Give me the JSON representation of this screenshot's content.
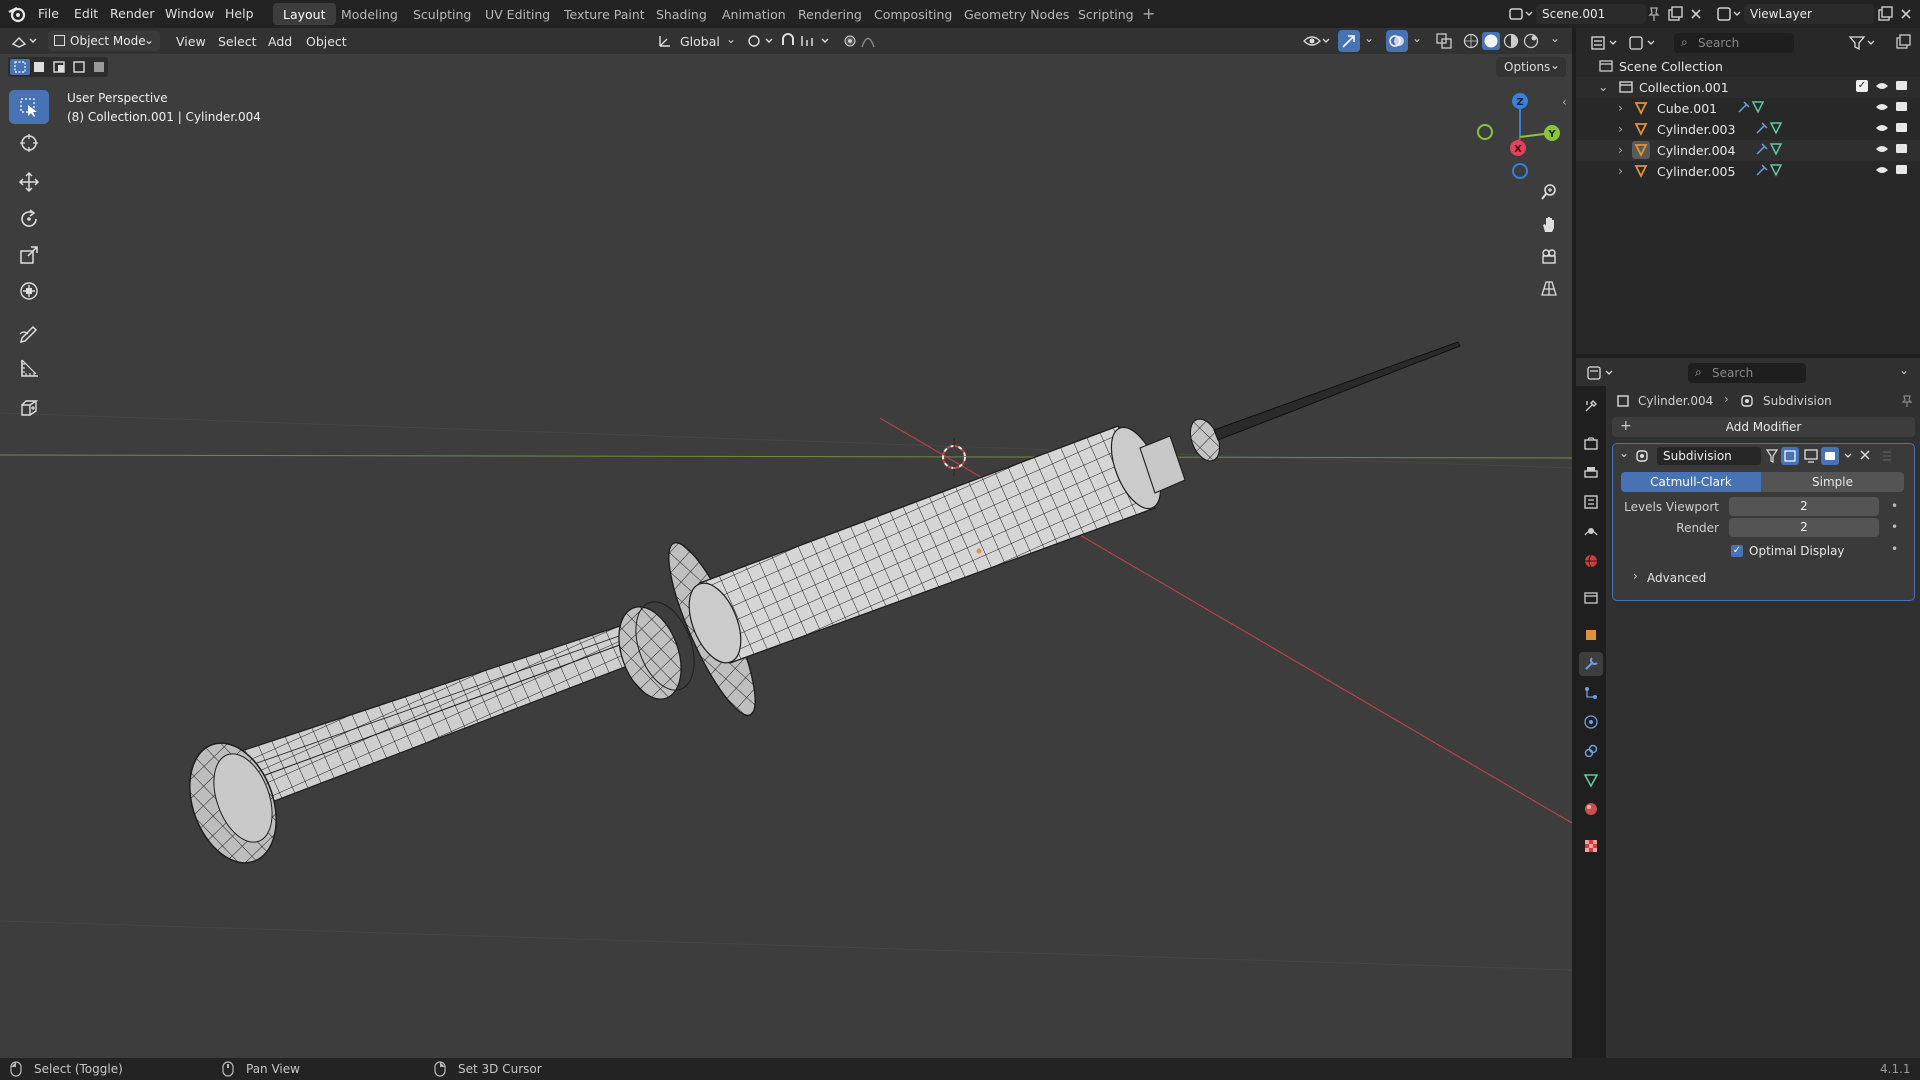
{
  "topbar": {
    "menus": [
      "File",
      "Edit",
      "Render",
      "Window",
      "Help"
    ],
    "workspaces": [
      "Layout",
      "Modeling",
      "Sculpting",
      "UV Editing",
      "Texture Paint",
      "Shading",
      "Animation",
      "Rendering",
      "Compositing",
      "Geometry Nodes",
      "Scripting"
    ],
    "active_workspace": "Layout",
    "add_tab": "+",
    "scene": "Scene.001",
    "view_layer": "ViewLayer"
  },
  "viewport_header": {
    "mode": "Object Mode",
    "menus": [
      "View",
      "Select",
      "Add",
      "Object"
    ],
    "orientation": "Global",
    "options": "Options"
  },
  "viewport": {
    "perspective": "User Perspective",
    "context": "(8) Collection.001 | Cylinder.004",
    "gizmo_axes": [
      "Z",
      "X",
      "Y"
    ]
  },
  "outliner": {
    "search_placeholder": "Search",
    "scene_collection": "Scene Collection",
    "collection": "Collection.001",
    "objects": [
      "Cube.001",
      "Cylinder.003",
      "Cylinder.004",
      "Cylinder.005"
    ]
  },
  "properties": {
    "search_placeholder": "Search",
    "breadcrumb_object": "Cylinder.004",
    "breadcrumb_modifier": "Subdivision",
    "add_modifier": "Add Modifier",
    "modifier_name": "Subdivision",
    "type_catmull": "Catmull-Clark",
    "type_simple": "Simple",
    "levels_viewport_label": "Levels Viewport",
    "levels_viewport_value": "2",
    "render_label": "Render",
    "render_value": "2",
    "optimal_display_label": "Optimal Display",
    "optimal_display_checked": true,
    "advanced_label": "Advanced"
  },
  "statusbar": {
    "select": "Select (Toggle)",
    "pan": "Pan View",
    "cursor": "Set 3D Cursor",
    "version": "4.1.1"
  },
  "colors": {
    "accent": "#4772b3",
    "x_axis": "#e0435a",
    "y_axis": "#8ac43f",
    "z_axis": "#3a7fd8",
    "object_orange": "#e0913a"
  }
}
